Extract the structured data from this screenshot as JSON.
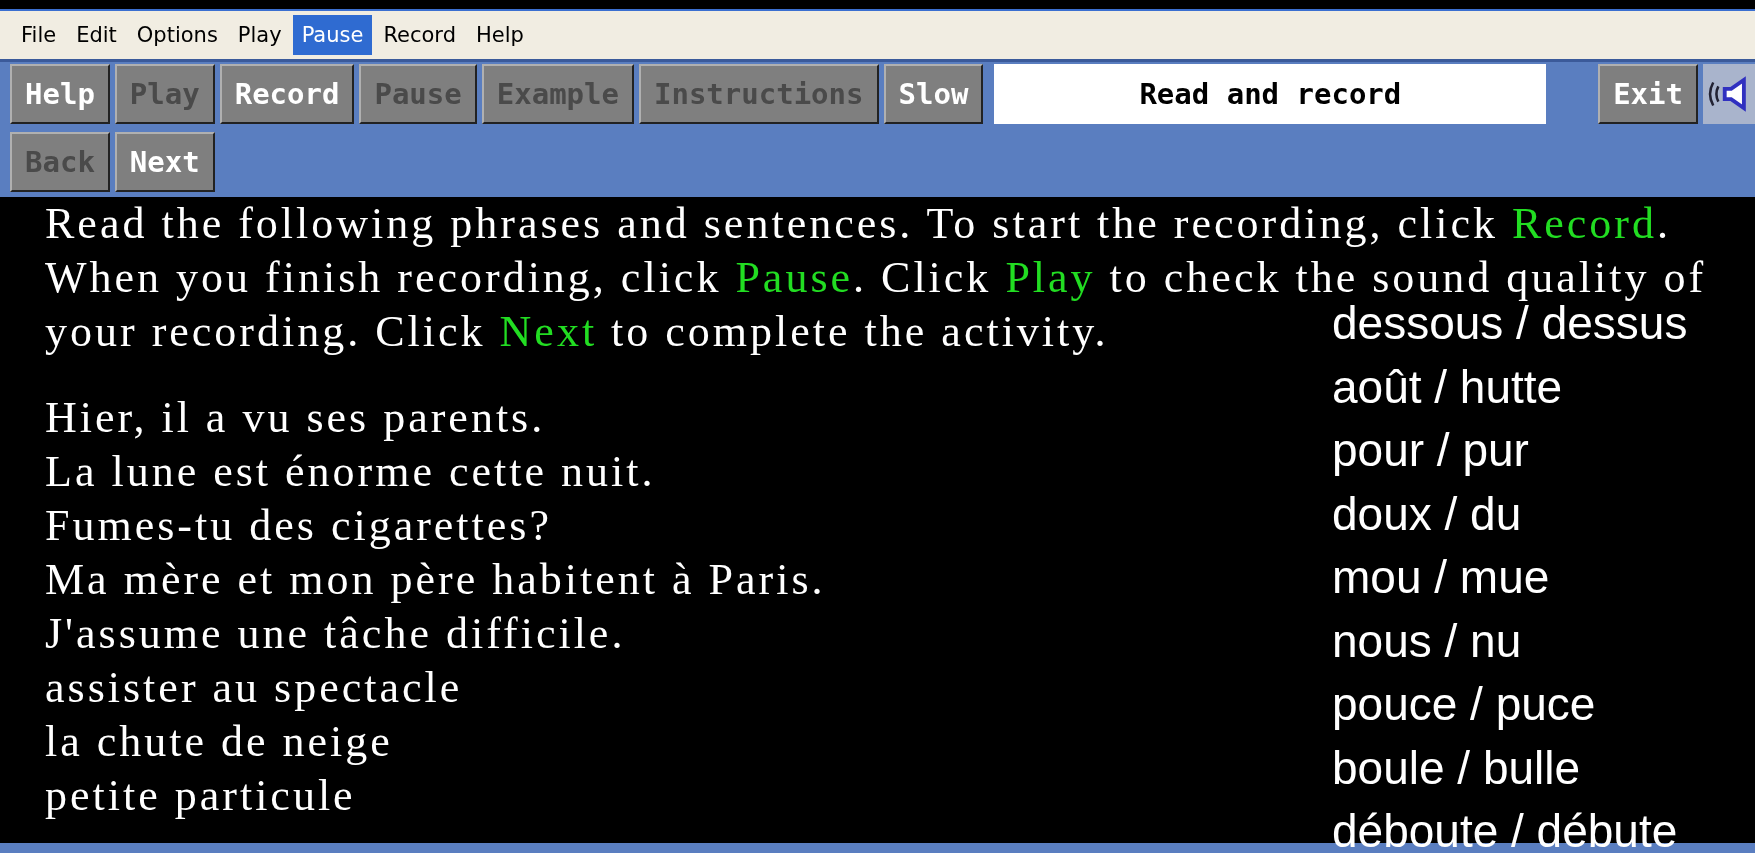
{
  "menu": [
    {
      "label": "File",
      "selected": false
    },
    {
      "label": "Edit",
      "selected": false
    },
    {
      "label": "Options",
      "selected": false
    },
    {
      "label": "Play",
      "selected": false
    },
    {
      "label": "Pause",
      "selected": true
    },
    {
      "label": "Record",
      "selected": false
    },
    {
      "label": "Help",
      "selected": false
    }
  ],
  "toolbar": [
    {
      "label": "Help",
      "disabled": false
    },
    {
      "label": "Play",
      "disabled": true
    },
    {
      "label": "Record",
      "disabled": false
    },
    {
      "label": "Pause",
      "disabled": true
    },
    {
      "label": "Example",
      "disabled": true
    },
    {
      "label": "Instructions",
      "disabled": true
    },
    {
      "label": "Slow",
      "disabled": false
    }
  ],
  "activity_title": "Read and record",
  "exit_button": {
    "label": "Exit",
    "disabled": false
  },
  "nav_buttons": [
    {
      "label": "Back",
      "disabled": true
    },
    {
      "label": "Next",
      "disabled": false
    }
  ],
  "instructions": [
    [
      {
        "text": "Read the following phrases and sentences. To start the recording, click ",
        "highlight": false
      },
      {
        "text": "Record",
        "highlight": true
      },
      {
        "text": ".",
        "highlight": false
      }
    ],
    [
      {
        "text": "When you finish recording, click ",
        "highlight": false
      },
      {
        "text": "Pause",
        "highlight": true
      },
      {
        "text": ". Click ",
        "highlight": false
      },
      {
        "text": "Play",
        "highlight": true
      },
      {
        "text": " to check the sound quality of",
        "highlight": false
      }
    ],
    [
      {
        "text": "your recording. Click ",
        "highlight": false
      },
      {
        "text": "Next",
        "highlight": true
      },
      {
        "text": " to complete the activity.",
        "highlight": false
      }
    ]
  ],
  "sentences": [
    "Hier, il a vu ses parents.",
    "La lune est énorme cette nuit.",
    "Fumes-tu des cigarettes?",
    "Ma mère et mon père habitent à Paris.",
    "J'assume une tâche difficile.",
    "assister au spectacle",
    "la chute de neige",
    "petite particule"
  ],
  "word_pairs": [
    "dessous / dessus",
    "août / hutte",
    "pour / pur",
    "doux / du",
    "mou / mue",
    "nous / nu",
    "pouce / puce",
    "boule / bulle",
    "déboute / débute"
  ]
}
